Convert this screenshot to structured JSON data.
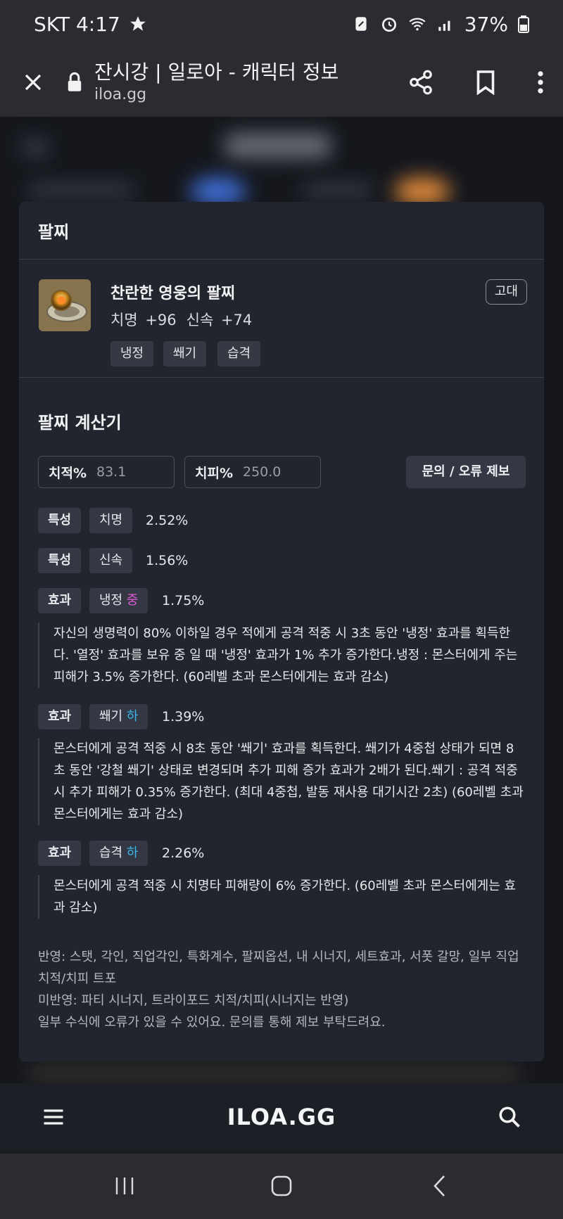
{
  "status_bar": {
    "carrier_time": "SKT 4:17",
    "battery": "37%",
    "icons": [
      "star-icon",
      "nfc-icon",
      "alarm-icon",
      "wifi-icon",
      "signal-icon",
      "battery-icon"
    ]
  },
  "browser": {
    "title": "잔시강 | 일로아 - 캐릭터 정보",
    "url": "iloa.gg",
    "icons": [
      "close-icon",
      "lock-icon",
      "share-icon",
      "bookmark-icon",
      "more-icon"
    ]
  },
  "card": {
    "header": "팔찌",
    "item": {
      "name": "찬란한 영웅의 팔찌",
      "stat1": "치명 +96",
      "stat2": "신속 +74",
      "grade": "고대",
      "tags": [
        "냉정",
        "쐐기",
        "습격"
      ]
    },
    "calculator": {
      "title": "팔찌 계산기",
      "crit_rate_label": "치적%",
      "crit_rate_value": "83.1",
      "crit_dmg_label": "치피%",
      "crit_dmg_value": "250.0",
      "report_button": "문의 / 오류 제보"
    },
    "rows": [
      {
        "kind": "특성",
        "name": "치명",
        "level": "",
        "value": "2.52%"
      },
      {
        "kind": "특성",
        "name": "신속",
        "level": "",
        "value": "1.56%"
      },
      {
        "kind": "효과",
        "name": "냉정",
        "level": "중",
        "value": "1.75%",
        "desc": "자신의 생명력이 80% 이하일 경우 적에게 공격 적중 시 3초 동안 '냉정' 효과를 획득한다. '열정' 효과를 보유 중 일 때 '냉정' 효과가 1% 추가 증가한다.냉정 : 몬스터에게 주는 피해가 3.5% 증가한다. (60레벨 초과 몬스터에게는 효과 감소)"
      },
      {
        "kind": "효과",
        "name": "쐐기",
        "level": "하",
        "value": "1.39%",
        "desc": "몬스터에게 공격 적중 시 8초 동안 '쐐기' 효과를 획득한다. 쐐기가 4중첩 상태가 되면 8초 동안 '강철 쐐기' 상태로 변경되며 추가 피해 증가 효과가 2배가 된다.쐐기 : 공격 적중 시 추가 피해가 0.35% 증가한다. (최대 4중첩, 발동 재사용 대기시간 2초) (60레벨 초과 몬스터에게는 효과 감소)"
      },
      {
        "kind": "효과",
        "name": "습격",
        "level": "하",
        "value": "2.26%",
        "desc": "몬스터에게 공격 적중 시 치명타 피해량이 6% 증가한다. (60레벨 초과 몬스터에게는 효과 감소)"
      }
    ],
    "footer": {
      "line1": "반영: 스탯, 각인, 직업각인, 특화계수, 팔찌옵션, 내 시너지, 세트효과, 서폿 갈망, 일부 직업 치적/치피 트포",
      "line2": "미반영: 파티 시너지, 트라이포드 치적/치피(시너지는 반영)",
      "line3": "일부 수식에 오류가 있을 수 있어요. 문의를 통해 제보 부탁드려요."
    }
  },
  "site_nav": {
    "logo": "ILOA.GG",
    "icons": [
      "menu-icon",
      "search-icon"
    ]
  },
  "android_nav": {
    "icons": [
      "recents-icon",
      "home-icon",
      "back-icon"
    ]
  },
  "colors": {
    "level_mid": "#e45bd8",
    "level_low": "#39b6ea",
    "card_bg": "#22252d",
    "chip_bg": "#343844"
  }
}
